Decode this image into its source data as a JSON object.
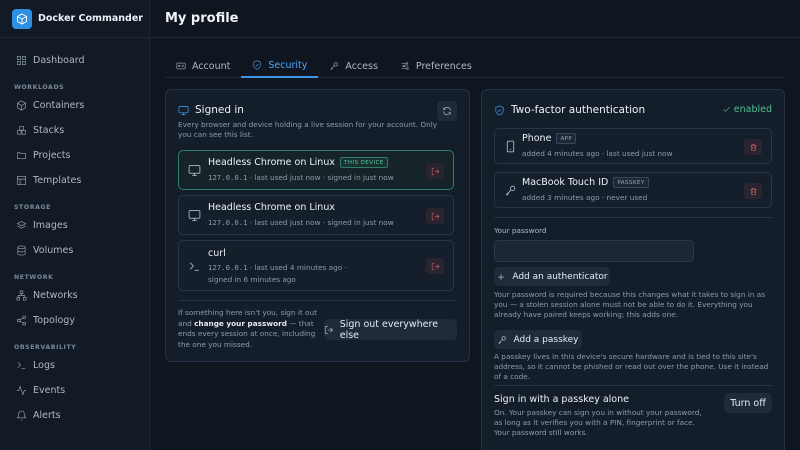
{
  "app": {
    "title": "Docker Commander"
  },
  "sidebar": {
    "dashboard": "Dashboard",
    "sections": {
      "workloads": "WORKLOADS",
      "storage": "STORAGE",
      "network": "NETWORK",
      "observability": "OBSERVABILITY"
    },
    "items": {
      "containers": "Containers",
      "stacks": "Stacks",
      "projects": "Projects",
      "templates": "Templates",
      "images": "Images",
      "volumes": "Volumes",
      "networks": "Networks",
      "topology": "Topology",
      "logs": "Logs",
      "events": "Events",
      "alerts": "Alerts"
    }
  },
  "header": {
    "title": "My profile"
  },
  "tabs": [
    {
      "label": "Account",
      "icon": "id-card-icon"
    },
    {
      "label": "Security",
      "icon": "shield-icon",
      "active": true
    },
    {
      "label": "Access",
      "icon": "key-icon"
    },
    {
      "label": "Preferences",
      "icon": "sliders-icon"
    }
  ],
  "signed_in": {
    "title": "Signed in",
    "description": "Every browser and device holding a live session for your account. Only you can see this list.",
    "sessions": [
      {
        "name": "Headless Chrome on Linux",
        "badge": "THIS DEVICE",
        "ip": "127.0.0.1",
        "used": "last used just now",
        "signed": "signed in just now",
        "icon": "monitor-icon"
      },
      {
        "name": "Headless Chrome on Linux",
        "ip": "127.0.0.1",
        "used": "last used just now",
        "signed": "signed in just now",
        "icon": "monitor-icon"
      },
      {
        "name": "curl",
        "ip": "127.0.0.1",
        "used": "last used 4 minutes ago",
        "signed": "signed in 6 minutes ago",
        "icon": "terminal-icon"
      }
    ],
    "footer_before": "If something here isn't you, sign it out and ",
    "footer_bold": "change your password",
    "footer_after": " — that ends every session at once, including the one you missed.",
    "sign_out_all": "Sign out everywhere else"
  },
  "twofa": {
    "title": "Two-factor authentication",
    "status": "enabled",
    "authenticators": [
      {
        "name": "Phone",
        "badge": "APP",
        "meta": "added 4 minutes ago · last used just now",
        "icon": "phone-icon"
      },
      {
        "name": "MacBook Touch ID",
        "badge": "PASSKEY",
        "meta": "added 3 minutes ago · never used",
        "icon": "key-icon"
      }
    ],
    "password_label": "Your password",
    "password_value": "",
    "add_authenticator": "Add an authenticator",
    "password_note": "Your password is required because this changes what it takes to sign in as you — a stolen session alone must not be able to do it. Everything you already have paired keeps working; this adds one.",
    "add_passkey": "Add a passkey",
    "passkey_note": "A passkey lives in this device's secure hardware and is tied to this site's address, so it cannot be phished or read out over the phone. Use it instead of a code.",
    "passkey_alone_title": "Sign in with a passkey alone",
    "passkey_alone_note": "On. Your passkey can sign you in without your password, as long as it verifies you with a PIN, fingerprint or face. Your password still works.",
    "turn_off": "Turn off"
  },
  "colors": {
    "accent": "#3e95e8",
    "success": "#4fbf8f",
    "danger": "#e06a6a",
    "background": "#0f1620"
  }
}
